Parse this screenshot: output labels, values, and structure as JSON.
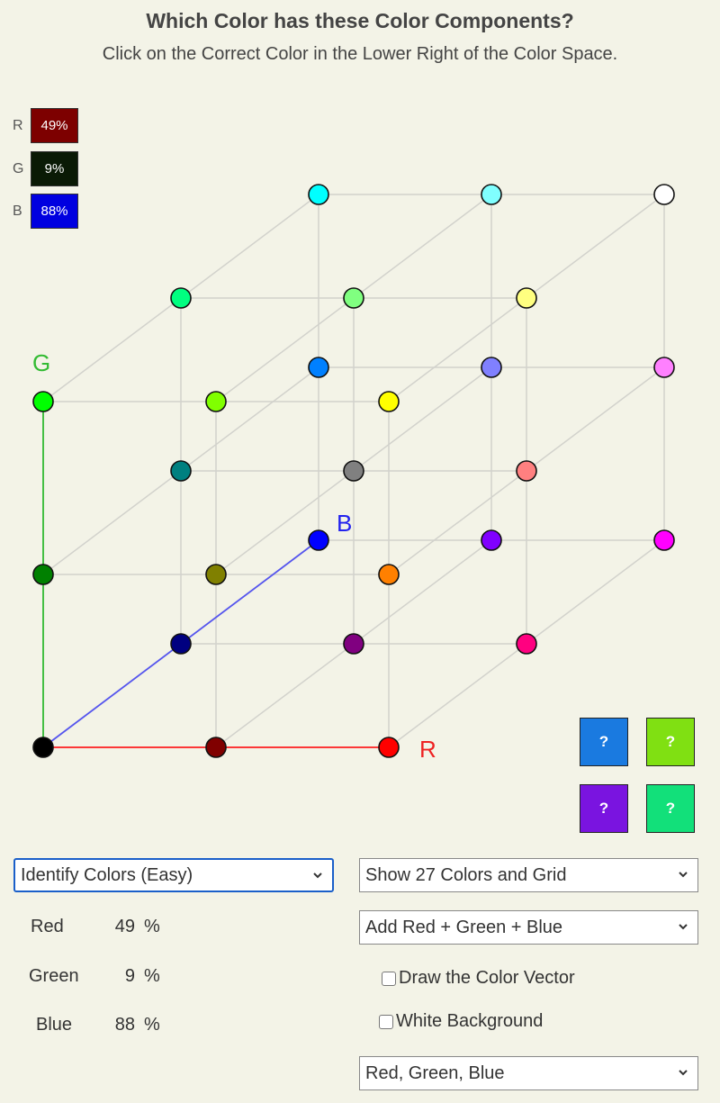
{
  "header": {
    "title": "Which Color has these Color Components?",
    "subtitle": "Click on the Correct Color in the Lower Right of the Color Space."
  },
  "components": [
    {
      "label": "R",
      "value": "49%",
      "color": "#7d0000"
    },
    {
      "label": "G",
      "value": "9%",
      "color": "#0a1a05"
    },
    {
      "label": "B",
      "value": "88%",
      "color": "#0000e0"
    }
  ],
  "cube": {
    "axis_labels": {
      "r": "R",
      "g": "G",
      "b": "B"
    },
    "axis_colors": {
      "r": "#ff2020",
      "g": "#33bb33",
      "b": "#5555ee"
    },
    "points": [
      {
        "name": "black",
        "r": 0,
        "g": 0,
        "b": 0,
        "color": "#000000"
      },
      {
        "name": "maroon",
        "r": 0.5,
        "g": 0,
        "b": 0,
        "color": "#800000"
      },
      {
        "name": "red",
        "r": 1,
        "g": 0,
        "b": 0,
        "color": "#ff0000"
      },
      {
        "name": "dark-green",
        "r": 0,
        "g": 0.5,
        "b": 0,
        "color": "#008000"
      },
      {
        "name": "olive",
        "r": 0.5,
        "g": 0.5,
        "b": 0,
        "color": "#808000"
      },
      {
        "name": "orange",
        "r": 1,
        "g": 0.5,
        "b": 0,
        "color": "#ff8000"
      },
      {
        "name": "green",
        "r": 0,
        "g": 1,
        "b": 0,
        "color": "#00ff00"
      },
      {
        "name": "chartreuse",
        "r": 0.5,
        "g": 1,
        "b": 0,
        "color": "#80ff00"
      },
      {
        "name": "yellow",
        "r": 1,
        "g": 1,
        "b": 0,
        "color": "#ffff00"
      },
      {
        "name": "navy",
        "r": 0,
        "g": 0,
        "b": 0.5,
        "color": "#000080"
      },
      {
        "name": "purple",
        "r": 0.5,
        "g": 0,
        "b": 0.5,
        "color": "#800080"
      },
      {
        "name": "deep-pink",
        "r": 1,
        "g": 0,
        "b": 0.5,
        "color": "#ff0080"
      },
      {
        "name": "teal",
        "r": 0,
        "g": 0.5,
        "b": 0.5,
        "color": "#008080"
      },
      {
        "name": "gray",
        "r": 0.5,
        "g": 0.5,
        "b": 0.5,
        "color": "#808080"
      },
      {
        "name": "salmon",
        "r": 1,
        "g": 0.5,
        "b": 0.5,
        "color": "#ff8080"
      },
      {
        "name": "spring-green",
        "r": 0,
        "g": 1,
        "b": 0.5,
        "color": "#00ff80"
      },
      {
        "name": "light-green",
        "r": 0.5,
        "g": 1,
        "b": 0.5,
        "color": "#80ff80"
      },
      {
        "name": "light-yellow",
        "r": 1,
        "g": 1,
        "b": 0.5,
        "color": "#ffff80"
      },
      {
        "name": "blue",
        "r": 0,
        "g": 0,
        "b": 1,
        "color": "#0000ff"
      },
      {
        "name": "violet",
        "r": 0.5,
        "g": 0,
        "b": 1,
        "color": "#8000ff"
      },
      {
        "name": "magenta",
        "r": 1,
        "g": 0,
        "b": 1,
        "color": "#ff00ff"
      },
      {
        "name": "azure",
        "r": 0,
        "g": 0.5,
        "b": 1,
        "color": "#0080ff"
      },
      {
        "name": "periwinkle",
        "r": 0.5,
        "g": 0.5,
        "b": 1,
        "color": "#8080ff"
      },
      {
        "name": "pink",
        "r": 1,
        "g": 0.5,
        "b": 1,
        "color": "#ff80ff"
      },
      {
        "name": "cyan",
        "r": 0,
        "g": 1,
        "b": 1,
        "color": "#00ffff"
      },
      {
        "name": "light-cyan",
        "r": 0.5,
        "g": 1,
        "b": 1,
        "color": "#80ffff"
      },
      {
        "name": "white",
        "r": 1,
        "g": 1,
        "b": 1,
        "color": "#ffffff"
      }
    ]
  },
  "answers": [
    {
      "label": "?",
      "color": "#1a7ae0"
    },
    {
      "label": "?",
      "color": "#80e012"
    },
    {
      "label": "?",
      "color": "#7a14e0"
    },
    {
      "label": "?",
      "color": "#12e07a"
    }
  ],
  "controls": {
    "mode_select": "Identify Colors (Easy)",
    "display_select": "Show 27 Colors and Grid",
    "mixing_select": "Add Red + Green + Blue",
    "draw_vector": {
      "label": "Draw the Color Vector",
      "checked": false
    },
    "white_background": {
      "label": "White Background",
      "checked": false
    },
    "color_model_select": "Red, Green, Blue"
  },
  "readouts": [
    {
      "label": "Red",
      "value": "49",
      "unit": "%"
    },
    {
      "label": "Green",
      "value": "9",
      "unit": "%"
    },
    {
      "label": "Blue",
      "value": "88",
      "unit": "%"
    }
  ]
}
